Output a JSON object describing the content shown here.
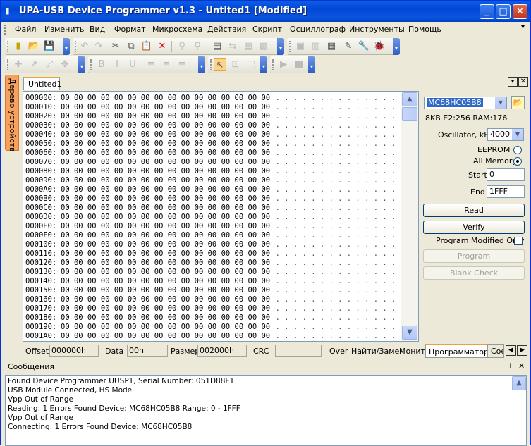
{
  "window": {
    "title": "UPA-USB Device Programmer v1.3 - Untited1 [Modified]"
  },
  "menu": [
    "Файл",
    "Изменить",
    "Вид",
    "Формат",
    "Микросхема",
    "Действия",
    "Скрипт",
    "Осциллограф",
    "Инструменты",
    "Помощь"
  ],
  "sidetab": {
    "label": "Дерево устройств"
  },
  "document": {
    "tab_label": "Untited1"
  },
  "hex": {
    "rows": [
      {
        "addr": "000000:",
        "bytes": "00 00 00 00 00 00 00 00 00 00 00 00 00 00 00 00",
        "ascii": ". . . . . . . . . . . . . . . ."
      },
      {
        "addr": "000010:",
        "bytes": "00 00 00 00 00 00 00 00 00 00 00 00 00 00 00 00",
        "ascii": ". . . . . . . . . . . . . . . ."
      },
      {
        "addr": "000020:",
        "bytes": "00 00 00 00 00 00 00 00 00 00 00 00 00 00 00 00",
        "ascii": ". . . . . . . . . . . . . . . ."
      },
      {
        "addr": "000030:",
        "bytes": "00 00 00 00 00 00 00 00 00 00 00 00 00 00 00 00",
        "ascii": ". . . . . . . . . . . . . . . ."
      },
      {
        "addr": "000040:",
        "bytes": "00 00 00 00 00 00 00 00 00 00 00 00 00 00 00 00",
        "ascii": ". . . . . . . . . . . . . . . ."
      },
      {
        "addr": "000050:",
        "bytes": "00 00 00 00 00 00 00 00 00 00 00 00 00 00 00 00",
        "ascii": ". . . . . . . . . . . . . . . ."
      },
      {
        "addr": "000060:",
        "bytes": "00 00 00 00 00 00 00 00 00 00 00 00 00 00 00 00",
        "ascii": ". . . . . . . . . . . . . . . ."
      },
      {
        "addr": "000070:",
        "bytes": "00 00 00 00 00 00 00 00 00 00 00 00 00 00 00 00",
        "ascii": ". . . . . . . . . . . . . . . ."
      },
      {
        "addr": "000080:",
        "bytes": "00 00 00 00 00 00 00 00 00 00 00 00 00 00 00 00",
        "ascii": ". . . . . . . . . . . . . . . ."
      },
      {
        "addr": "000090:",
        "bytes": "00 00 00 00 00 00 00 00 00 00 00 00 00 00 00 00",
        "ascii": ". . . . . . . . . . . . . . . ."
      },
      {
        "addr": "0000A0:",
        "bytes": "00 00 00 00 00 00 00 00 00 00 00 00 00 00 00 00",
        "ascii": ". . . . . . . . . . . . . . . ."
      },
      {
        "addr": "0000B0:",
        "bytes": "00 00 00 00 00 00 00 00 00 00 00 00 00 00 00 00",
        "ascii": ". . . . . . . . . . . . . . . ."
      },
      {
        "addr": "0000C0:",
        "bytes": "00 00 00 00 00 00 00 00 00 00 00 00 00 00 00 00",
        "ascii": ". . . . . . . . . . . . . . . ."
      },
      {
        "addr": "0000D0:",
        "bytes": "00 00 00 00 00 00 00 00 00 00 00 00 00 00 00 00",
        "ascii": ". . . . . . . . . . . . . . . ."
      },
      {
        "addr": "0000E0:",
        "bytes": "00 00 00 00 00 00 00 00 00 00 00 00 00 00 00 00",
        "ascii": ". . . . . . . . . . . . . . . ."
      },
      {
        "addr": "0000F0:",
        "bytes": "00 00 00 00 00 00 00 00 00 00 00 00 00 00 00 00",
        "ascii": ". . . . . . . . . . . . . . . ."
      },
      {
        "addr": "000100:",
        "bytes": "00 00 00 00 00 00 00 00 00 00 00 00 00 00 00 00",
        "ascii": ". . . . . . . . . . . . . . . ."
      },
      {
        "addr": "000110:",
        "bytes": "00 00 00 00 00 00 00 00 00 00 00 00 00 00 00 00",
        "ascii": ". . . . . . . . . . . . . . . ."
      },
      {
        "addr": "000120:",
        "bytes": "00 00 00 00 00 00 00 00 00 00 00 00 00 00 00 00",
        "ascii": ". . . . . . . . . . . . . . . ."
      },
      {
        "addr": "000130:",
        "bytes": "00 00 00 00 00 00 00 00 00 00 00 00 00 00 00 00",
        "ascii": ". . . . . . . . . . . . . . . ."
      },
      {
        "addr": "000140:",
        "bytes": "00 00 00 00 00 00 00 00 00 00 00 00 00 00 00 00",
        "ascii": ". . . . . . . . . . . . . . . ."
      },
      {
        "addr": "000150:",
        "bytes": "00 00 00 00 00 00 00 00 00 00 00 00 00 00 00 00",
        "ascii": ". . . . . . . . . . . . . . . ."
      },
      {
        "addr": "000160:",
        "bytes": "00 00 00 00 00 00 00 00 00 00 00 00 00 00 00 00",
        "ascii": ". . . . . . . . . . . . . . . ."
      },
      {
        "addr": "000170:",
        "bytes": "00 00 00 00 00 00 00 00 00 00 00 00 00 00 00 00",
        "ascii": ". . . . . . . . . . . . . . . ."
      },
      {
        "addr": "000180:",
        "bytes": "00 00 00 00 00 00 00 00 00 00 00 00 00 00 00 00",
        "ascii": ". . . . . . . . . . . . . . . ."
      },
      {
        "addr": "000190:",
        "bytes": "00 00 00 00 00 00 00 00 00 00 00 00 00 00 00 00",
        "ascii": ". . . . . . . . . . . . . . . ."
      },
      {
        "addr": "0001A0:",
        "bytes": "00 00 00 00 00 00 00 00 00 00 00 00 00 00 00 00",
        "ascii": ". . . . . . . . . . . . . . . ."
      }
    ]
  },
  "statusbar": {
    "offset_label": "Offset",
    "offset_value": "000000h",
    "data_label": "Data",
    "data_value": "00h",
    "size_label": "Размер",
    "size_value": "002000h",
    "crc_label": "CRC",
    "crc_value": "",
    "over_label": "Over",
    "find_label": "Найти/Замен",
    "monitor_label": "Монит"
  },
  "programmer": {
    "device": "MC68HC05B8",
    "device_info": "8KB E2:256 RAM:176",
    "oscillator_label": "Oscillator, kHz",
    "oscillator_value": "4000",
    "eeprom_label": "EEPROM",
    "eeprom_selected": false,
    "allmemory_label": "All Memory",
    "allmemory_selected": true,
    "start_label": "Start",
    "start_value": "0",
    "end_label": "End",
    "end_value": "1FFF",
    "read_label": "Read",
    "verify_label": "Verify",
    "modified_only_label": "Program Modified Only",
    "modified_only_checked": false,
    "program_label": "Program",
    "blankcheck_label": "Blank Check"
  },
  "panel_tabs": {
    "active": "Программатор",
    "next": "Сое"
  },
  "messages": {
    "title": "Сообщения",
    "lines": [
      "Found Device Programmer UUSP1, Serial Number: 051D88F1",
      "USB Module Connected, HS Mode",
      "Vpp Out of Range",
      "Reading:  1 Errors Found   Device: MC68HC05B8 Range: 0 - 1FFF",
      "Vpp Out of Range",
      "Connecting:  1 Errors Found   Device: MC68HC05B8"
    ]
  },
  "colors": {
    "titlebar": "#0a54e0",
    "accent_tab": "#e6a23c",
    "sidetab": "#f6a15e"
  }
}
